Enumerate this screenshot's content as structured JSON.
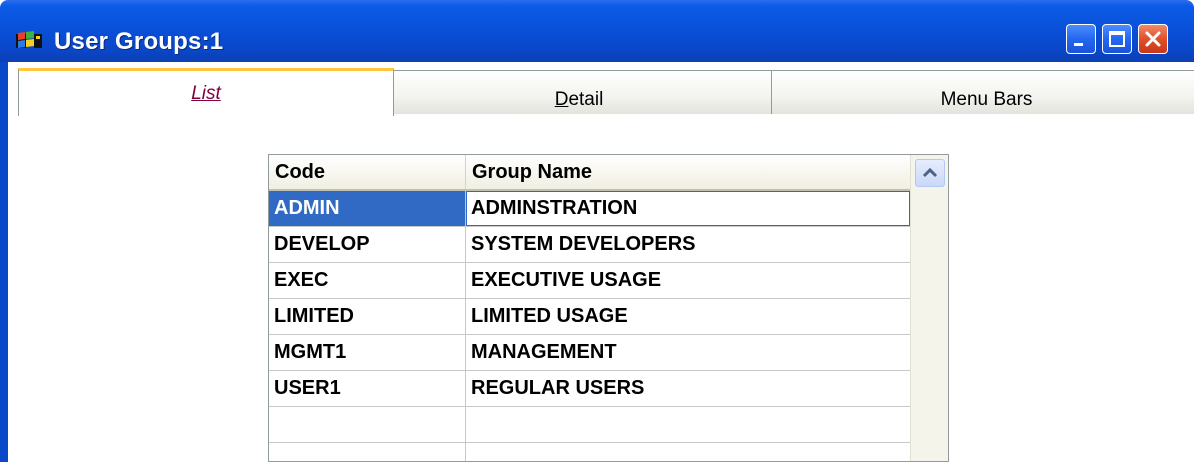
{
  "window": {
    "title": "User Groups:1"
  },
  "tabs": [
    {
      "label": "List",
      "active": true
    },
    {
      "label": "Detail",
      "active": false,
      "mnemonic": "D",
      "rest": "etail"
    },
    {
      "label": "Menu Bars",
      "active": false
    }
  ],
  "grid": {
    "columns": [
      "Code",
      "Group Name"
    ],
    "rows": [
      {
        "code": "ADMIN",
        "name": "ADMINSTRATION",
        "selected": true
      },
      {
        "code": "DEVELOP",
        "name": "SYSTEM DEVELOPERS"
      },
      {
        "code": "EXEC",
        "name": "EXECUTIVE USAGE"
      },
      {
        "code": "LIMITED",
        "name": "LIMITED USAGE"
      },
      {
        "code": "MGMT1",
        "name": "MANAGEMENT"
      },
      {
        "code": "USER1",
        "name": "REGULAR USERS"
      },
      {
        "code": "",
        "name": ""
      },
      {
        "code": "",
        "name": ""
      }
    ]
  },
  "colors": {
    "titlebar": "#0a4fd8",
    "selection": "#316ac5",
    "active_tab_accent": "#ffc83c",
    "active_tab_text": "#800040"
  }
}
